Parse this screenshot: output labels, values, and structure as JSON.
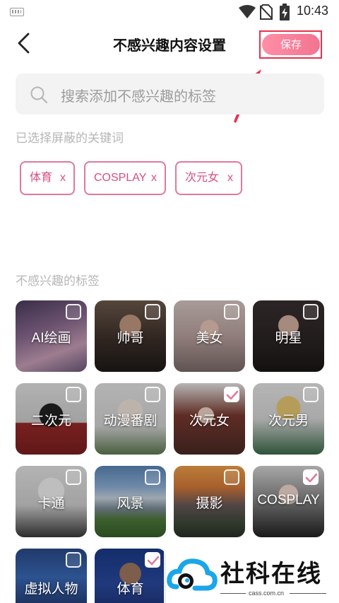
{
  "status_bar": {
    "time": "10:43"
  },
  "header": {
    "title": "不感兴趣内容设置",
    "save_label": "保存"
  },
  "search": {
    "placeholder": "搜索添加不感兴趣的标签"
  },
  "selected_section": {
    "label": "已选择屏蔽的关键词",
    "keywords": [
      {
        "text": "体育",
        "remove": "x"
      },
      {
        "text": "COSPLAY",
        "remove": "x"
      },
      {
        "text": "次元女",
        "remove": "x"
      }
    ]
  },
  "interest_section": {
    "label": "不感兴趣的标签",
    "tags": [
      {
        "label": "AI绘画",
        "checked": false
      },
      {
        "label": "帅哥",
        "checked": false
      },
      {
        "label": "美女",
        "checked": false
      },
      {
        "label": "明星",
        "checked": false
      },
      {
        "label": "二次元",
        "checked": false
      },
      {
        "label": "动漫番剧",
        "checked": false
      },
      {
        "label": "次元女",
        "checked": true
      },
      {
        "label": "次元男",
        "checked": false
      },
      {
        "label": "卡通",
        "checked": false
      },
      {
        "label": "风景",
        "checked": false
      },
      {
        "label": "摄影",
        "checked": false
      },
      {
        "label": "COSPLAY",
        "checked": true
      },
      {
        "label": "虚拟人物",
        "checked": false
      },
      {
        "label": "体育",
        "checked": true
      }
    ]
  },
  "watermark": {
    "name": "社科在线",
    "url": "cass.com.cn"
  },
  "colors": {
    "accent": "#e0799a",
    "save_gradient_start": "#ff8ea5",
    "annotation_red": "#e8314a"
  }
}
